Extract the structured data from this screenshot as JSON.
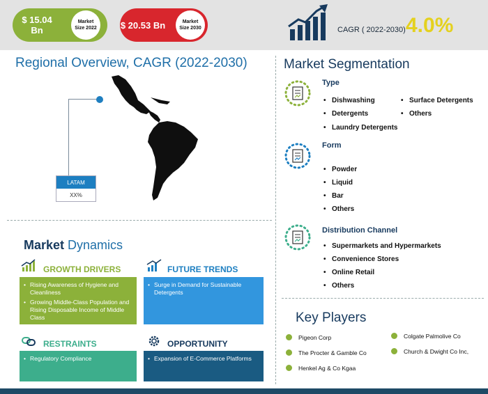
{
  "header": {
    "market_2022_value": "$ 15.04",
    "market_2022_unit": "Bn",
    "market_2022_label_line1": "Market",
    "market_2022_label_line2": "Size 2022",
    "market_2030_value": "$ 20.53 Bn",
    "market_2030_label_line1": "Market",
    "market_2030_label_line2": "Size 2030",
    "cagr_label": "CAGR ( 2022-2030)",
    "cagr_value": "4.0%",
    "growth_icon": "bar-chart-arrow-icon"
  },
  "regional": {
    "title": "Regional Overview,  CAGR (2022-2030)",
    "region_tag": "LATAM",
    "region_value": "XX%"
  },
  "dynamics": {
    "title_part1": "Market",
    "title_part2": " Dynamics",
    "growth_drivers": {
      "label": "GROWTH DRIVERS",
      "icon": "growth-chart-icon",
      "items": [
        "Rising Awareness of Hygiene and Cleanliness",
        "Growing Middle-Class Population and Rising Disposable Income of Middle Class"
      ]
    },
    "future_trends": {
      "label": "FUTURE TRENDS",
      "icon": "trend-icon",
      "items": [
        "Surge in Demand for Sustainable Detergents"
      ]
    },
    "restraints": {
      "label": "RESTRAINTS",
      "icon": "chain-icon",
      "items": [
        "Regulatory Compliance"
      ]
    },
    "opportunity": {
      "label": "OPPORTUNITY",
      "icon": "gear-icon",
      "items": [
        "Expansion of E-Commerce Platforms"
      ]
    }
  },
  "segmentation": {
    "title": "Market Segmentation",
    "type": {
      "label": "Type",
      "items": [
        "Dishwashing",
        "Detergents",
        "Laundry Detergents",
        "Surface Detergents",
        "Others"
      ]
    },
    "form": {
      "label": "Form",
      "items": [
        "Powder",
        "Liquid",
        "Bar",
        "Others"
      ]
    },
    "distribution": {
      "label": "Distribution Channel",
      "items": [
        "Supermarkets and Hypermarkets",
        "Convenience Stores",
        "Online Retail",
        "Others"
      ]
    }
  },
  "key_players": {
    "title": "Key Players",
    "items": [
      "Pigeon Corp",
      "The Procter & Gamble Co",
      "Henkel Ag & Co Kgaa",
      "Colgate Palmolive Co",
      "Church & Dwight Co Inc,"
    ]
  },
  "colors": {
    "green": "#8cb13a",
    "red": "#d8262d",
    "blue": "#1d7fc1",
    "navy": "#173a5e",
    "yellow": "#e4d11f",
    "teal": "#3dae8c"
  }
}
